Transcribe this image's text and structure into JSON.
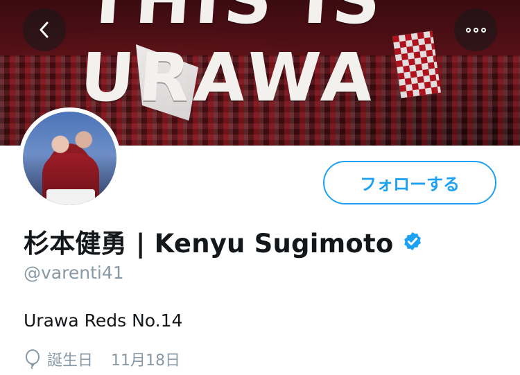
{
  "banner": {
    "slogan": "THIS IS URAWA"
  },
  "nav": {
    "back_icon": "chevron-left-icon",
    "more_icon": "more-horizontal-icon"
  },
  "profile": {
    "follow_label": "フォローする",
    "display_name": "杉本健勇 | Kenyu Sugimoto",
    "verified_icon": "verified-badge-icon",
    "handle": "@varenti41",
    "bio": "Urawa Reds No.14",
    "birthday_label": "誕生日",
    "birthday_value": "11月18日",
    "birthday_icon": "balloon-icon"
  },
  "colors": {
    "accent": "#1da1f2",
    "text": "#14171a",
    "muted": "#8899a6"
  }
}
